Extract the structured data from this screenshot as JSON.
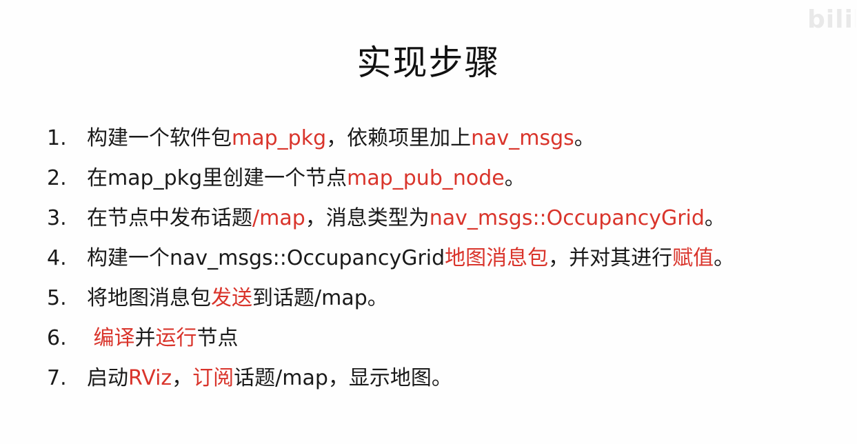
{
  "watermark": "bilibili",
  "title": "实现步骤",
  "steps": [
    {
      "num": "1.",
      "parts": [
        {
          "text": "构建一个软件包",
          "hl": false
        },
        {
          "text": "map_pkg",
          "hl": true
        },
        {
          "text": "，依赖项里加上",
          "hl": false
        },
        {
          "text": "nav_msgs",
          "hl": true
        },
        {
          "text": "。",
          "hl": false
        }
      ]
    },
    {
      "num": "2.",
      "parts": [
        {
          "text": "在map_pkg里创建一个节点",
          "hl": false
        },
        {
          "text": "map_pub_node",
          "hl": true
        },
        {
          "text": "。",
          "hl": false
        }
      ]
    },
    {
      "num": "3.",
      "parts": [
        {
          "text": "在节点中发布话题",
          "hl": false
        },
        {
          "text": "/map",
          "hl": true
        },
        {
          "text": "，消息类型为",
          "hl": false
        },
        {
          "text": "nav_msgs::OccupancyGrid",
          "hl": true
        },
        {
          "text": "。",
          "hl": false
        }
      ]
    },
    {
      "num": "4.",
      "parts": [
        {
          "text": "构建一个nav_msgs::OccupancyGrid",
          "hl": false
        },
        {
          "text": "地图消息包",
          "hl": true
        },
        {
          "text": "，并对其进行",
          "hl": false
        },
        {
          "text": "赋值",
          "hl": true
        },
        {
          "text": "。",
          "hl": false
        }
      ]
    },
    {
      "num": "5.",
      "parts": [
        {
          "text": "将地图消息包",
          "hl": false
        },
        {
          "text": "发送",
          "hl": true
        },
        {
          "text": "到话题/map。",
          "hl": false
        }
      ]
    },
    {
      "num": "6.",
      "parts": [
        {
          "text": " ",
          "hl": false
        },
        {
          "text": "编译",
          "hl": true
        },
        {
          "text": "并",
          "hl": false
        },
        {
          "text": "运行",
          "hl": true
        },
        {
          "text": "节点",
          "hl": false
        }
      ]
    },
    {
      "num": "7.",
      "parts": [
        {
          "text": "启动",
          "hl": false
        },
        {
          "text": "RViz",
          "hl": true
        },
        {
          "text": "，",
          "hl": false
        },
        {
          "text": "订阅",
          "hl": true
        },
        {
          "text": "话题/map，显示地图。",
          "hl": false
        }
      ]
    }
  ],
  "colors": {
    "text": "#1a1a1a",
    "highlight": "#d9342b"
  }
}
